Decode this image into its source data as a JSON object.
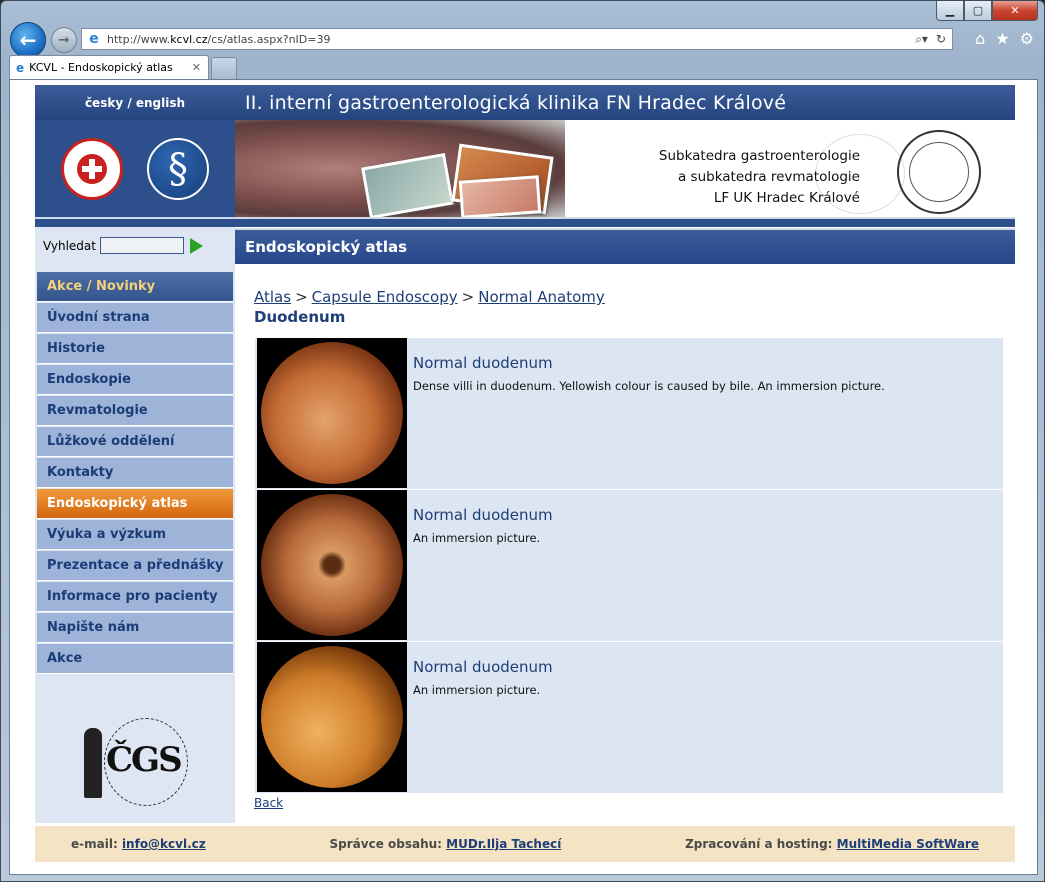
{
  "browser": {
    "url_prefix": "http://www.",
    "url_host": "kcvl.cz",
    "url_path": "/cs/atlas.aspx?nID=39",
    "tab_title": "KCVL - Endoskopický atlas",
    "tab_close": "✕",
    "icons": {
      "back": "arrow-left",
      "forward": "arrow-right",
      "home": "home-icon",
      "favorites": "star-icon",
      "settings": "gear-icon"
    }
  },
  "header": {
    "lang_switch": "česky / english",
    "title": "II. interní gastroenterologická klinika FN Hradec Králové",
    "subtitle_lines": [
      "Subkatedra gastroenterologie",
      "a subkatedra revmatologie",
      "LF UK Hradec Králové"
    ]
  },
  "search": {
    "label": "Vyhledat",
    "value": ""
  },
  "menu": [
    {
      "label": "Akce / Novinky",
      "state": "first"
    },
    {
      "label": "Úvodní strana",
      "state": ""
    },
    {
      "label": "Historie",
      "state": ""
    },
    {
      "label": "Endoskopie",
      "state": ""
    },
    {
      "label": "Revmatologie",
      "state": ""
    },
    {
      "label": "Lůžkové oddělení",
      "state": ""
    },
    {
      "label": "Kontakty",
      "state": ""
    },
    {
      "label": "Endoskopický atlas",
      "state": "active"
    },
    {
      "label": "Výuka a výzkum",
      "state": ""
    },
    {
      "label": "Prezentace a přednášky",
      "state": ""
    },
    {
      "label": "Informace pro pacienty",
      "state": ""
    },
    {
      "label": "Napište nám",
      "state": ""
    },
    {
      "label": "Akce",
      "state": ""
    }
  ],
  "content": {
    "section_title": "Endoskopický atlas",
    "breadcrumbs": [
      "Atlas",
      "Capsule Endoscopy",
      "Normal Anatomy"
    ],
    "breadcrumb_sep": ">",
    "heading": "Duodenum",
    "entries": [
      {
        "title": "Normal duodenum",
        "description": "Dense villi in duodenum. Yellowish colour is caused by bile. An  immersion picture."
      },
      {
        "title": "Normal duodenum",
        "description": "An  immersion picture."
      },
      {
        "title": "Normal duodenum",
        "description": "An  immersion picture."
      }
    ],
    "back_label": "Back"
  },
  "footer": {
    "email_label": "e-mail:",
    "email": "info@kcvl.cz",
    "admin_label": "Správce obsahu:",
    "admin": "MUDr.Ilja Tachecí",
    "hosting_label": "Zpracování a hosting:",
    "hosting": "MultiMedia SoftWare"
  },
  "colors": {
    "header_blue": "#2d4f8c",
    "menu_blue": "#9db4d8",
    "active_orange": "#e07a1f",
    "footer_beige": "#f5e4c4",
    "link": "#1d3e78"
  }
}
